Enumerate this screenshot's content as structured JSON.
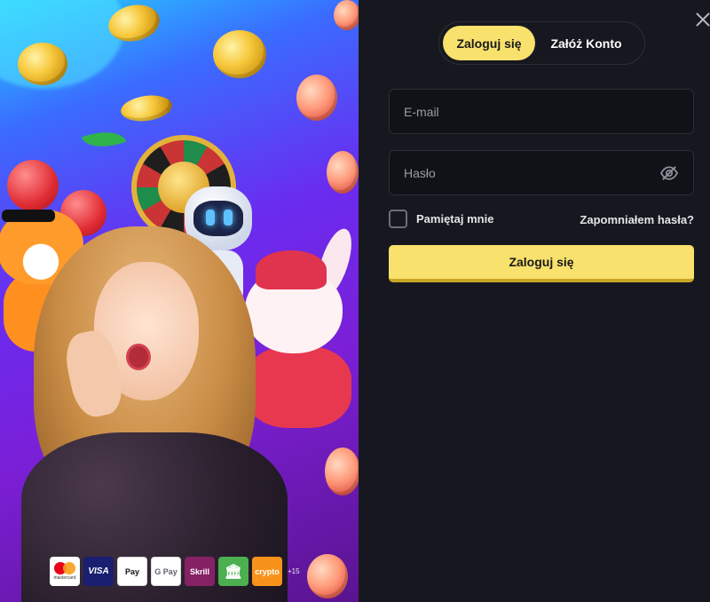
{
  "promo": {
    "payment_methods": [
      {
        "name": "Mastercard",
        "label": "mastercard",
        "icon": "mastercard-icon"
      },
      {
        "name": "Visa",
        "label": "VISA",
        "icon": "visa-icon"
      },
      {
        "name": "Apple Pay",
        "label": "Pay",
        "icon": "apple-pay-icon"
      },
      {
        "name": "Google Pay",
        "label": "G Pay",
        "icon": "google-pay-icon"
      },
      {
        "name": "Skrill",
        "label": "Skrill",
        "icon": "skrill-icon"
      },
      {
        "name": "Bank",
        "label": "🏛",
        "icon": "bank-icon"
      },
      {
        "name": "Crypto",
        "label": "crypto",
        "icon": "crypto-icon"
      }
    ],
    "more_label": "+15"
  },
  "tabs": {
    "login": "Zaloguj się",
    "register": "Załóż Konto"
  },
  "form": {
    "email_placeholder": "E-mail",
    "password_placeholder": "Hasło",
    "remember_label": "Pamiętaj mnie",
    "forgot_label": "Zapomniałem hasła?",
    "submit_label": "Zaloguj się"
  },
  "colors": {
    "accent": "#f8e16c",
    "panel_bg": "#17181f",
    "field_bg": "#111217"
  }
}
